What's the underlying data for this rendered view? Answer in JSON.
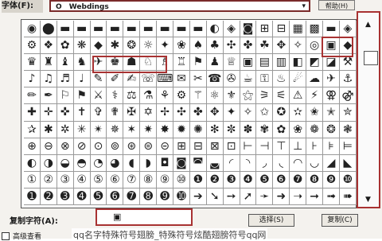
{
  "toolbar": {
    "font_label": "字体(F):",
    "font_symbol": "O",
    "font_name": "Webdings",
    "dropdown_arrow": "▾",
    "help_label": "帮助(H)"
  },
  "grid": {
    "glyphs": [
      "◉",
      "⬤",
      "▬",
      "▬",
      "▬",
      "▬",
      "▬",
      "▬",
      "▬",
      "▬",
      "▬",
      "◐",
      "◈",
      "◙",
      "⊞",
      "⊟",
      "▦",
      "▩",
      "▬",
      "◈",
      "⚙",
      "❖",
      "✿",
      "❋",
      "◆",
      "✱",
      "❂",
      "☼",
      "✦",
      "❀",
      "♠",
      "♣",
      "✣",
      "✤",
      "☘",
      "✥",
      "✧",
      "◎",
      "▣",
      "◆",
      "♛",
      "♜",
      "♝",
      "♞",
      "✈",
      "♚",
      "☗",
      "♘",
      "♗",
      "♖",
      "⚑",
      "♟",
      "♕",
      "▣",
      "▤",
      "▥",
      "◧",
      "◩",
      "◪",
      "⚒",
      "♪",
      "♫",
      "♬",
      "♩",
      "✎",
      "✐",
      "✍",
      "☏",
      "⌨",
      "✉",
      "✂",
      "☎",
      "✇",
      "☕",
      "⚿",
      "♨",
      "☄",
      "☁",
      "✈",
      "⚓",
      "✏",
      "✒",
      "⚐",
      "⚑",
      "⚔",
      "⚕",
      "⚖",
      "⚗",
      "⚘",
      "⚙",
      "⚚",
      "⚛",
      "⚜",
      "⚝",
      "⚞",
      "⚟",
      "⚠",
      "⚡",
      "⚢",
      "⚣",
      "✚",
      "✛",
      "✜",
      "✝",
      "✞",
      "✟",
      "✠",
      "✡",
      "✢",
      "✣",
      "✤",
      "✥",
      "✦",
      "✧",
      "✩",
      "✪",
      "✫",
      "✬",
      "✭",
      "✮",
      "✰",
      "✱",
      "✲",
      "✳",
      "✴",
      "✵",
      "✶",
      "✷",
      "✸",
      "✹",
      "✺",
      "✻",
      "✼",
      "✽",
      "✾",
      "✿",
      "❀",
      "❁",
      "❂",
      "❃",
      "⊕",
      "⊖",
      "⊗",
      "⊘",
      "⊙",
      "⊚",
      "⊛",
      "⊜",
      "⊝",
      "⊞",
      "⊟",
      "⊠",
      "⊡",
      "⊢",
      "⊣",
      "⊤",
      "⊥",
      "⊦",
      "⊧",
      "⊨",
      "◐",
      "◑",
      "◒",
      "◓",
      "◔",
      "◕",
      "◖",
      "◗",
      "◘",
      "◙",
      "◚",
      "◛",
      "◜",
      "◝",
      "◞",
      "◟",
      "◠",
      "◡",
      "◢",
      "◣",
      "①",
      "②",
      "③",
      "④",
      "⑤",
      "⑥",
      "⑦",
      "⑧",
      "⑨",
      "⑩",
      "❶",
      "❷",
      "❸",
      "❹",
      "❺",
      "❻",
      "❼",
      "❽",
      "❾",
      "❿",
      "➊",
      "➋",
      "➌",
      "➍",
      "➎",
      "➏",
      "➐",
      "➑",
      "➒",
      "➓",
      "➔",
      "➘",
      "➙",
      "➚",
      "➛",
      "➜",
      "➝",
      "➞",
      "➟",
      "➠"
    ]
  },
  "scroll": {
    "up_arrow": "▲",
    "down_arrow": "▼"
  },
  "copy": {
    "label": "复制字符(A):",
    "value": "▣",
    "select_label": "选择(S)",
    "copy_label": "复制(C)"
  },
  "advanced": {
    "label": "高级查看"
  },
  "caption": "qq名字特殊符号翅膀_特殊符号炫酷翅膀符号qq网"
}
